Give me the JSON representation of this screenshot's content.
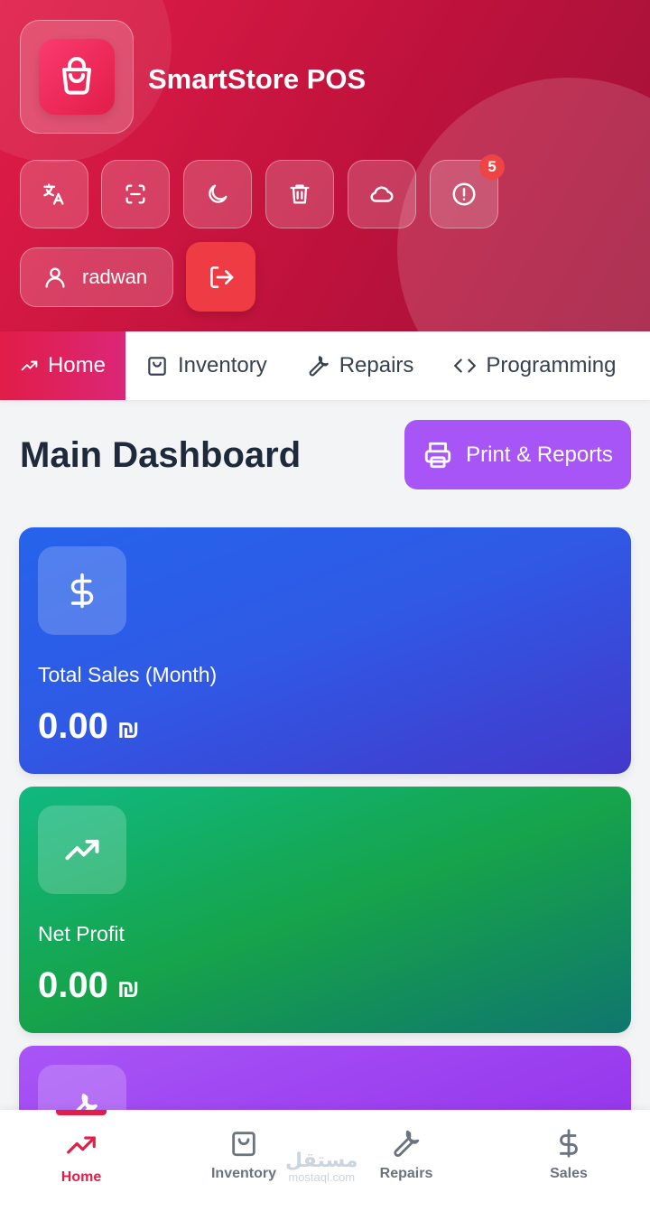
{
  "app": {
    "title": "SmartStore POS"
  },
  "toolbar": {
    "buttons": [
      {
        "name": "translate",
        "icon": "translate-icon"
      },
      {
        "name": "scan",
        "icon": "scan-icon"
      },
      {
        "name": "dark-mode",
        "icon": "moon-icon"
      },
      {
        "name": "delete",
        "icon": "trash-icon"
      },
      {
        "name": "cloud",
        "icon": "cloud-icon"
      },
      {
        "name": "alerts",
        "icon": "alert-circle-icon",
        "badge": "5"
      }
    ]
  },
  "user": {
    "name": "radwan"
  },
  "tabs": [
    {
      "label": "Home",
      "icon": "trending-up-icon",
      "active": true
    },
    {
      "label": "Inventory",
      "icon": "shopping-bag-icon"
    },
    {
      "label": "Repairs",
      "icon": "wrench-icon"
    },
    {
      "label": "Programming",
      "icon": "code-icon"
    }
  ],
  "main": {
    "title": "Main Dashboard",
    "print_label": "Print & Reports"
  },
  "cards": [
    {
      "label": "Total Sales (Month)",
      "value": "0.00",
      "currency": "₪",
      "icon": "dollar-icon"
    },
    {
      "label": "Net Profit",
      "value": "0.00",
      "currency": "₪",
      "icon": "trending-up-icon"
    }
  ],
  "bottom_nav": [
    {
      "label": "Home",
      "icon": "trending-up-icon",
      "active": true
    },
    {
      "label": "Inventory",
      "icon": "shopping-bag-icon"
    },
    {
      "label": "Repairs",
      "icon": "wrench-icon"
    },
    {
      "label": "Sales",
      "icon": "dollar-icon"
    }
  ],
  "watermark": {
    "arabic": "مستقل",
    "latin": "mostaql.com"
  },
  "colors": {
    "primary": "#e11d48",
    "accent_purple": "#a855f7",
    "blue_card": "#2563eb",
    "green_card": "#16a34a"
  }
}
